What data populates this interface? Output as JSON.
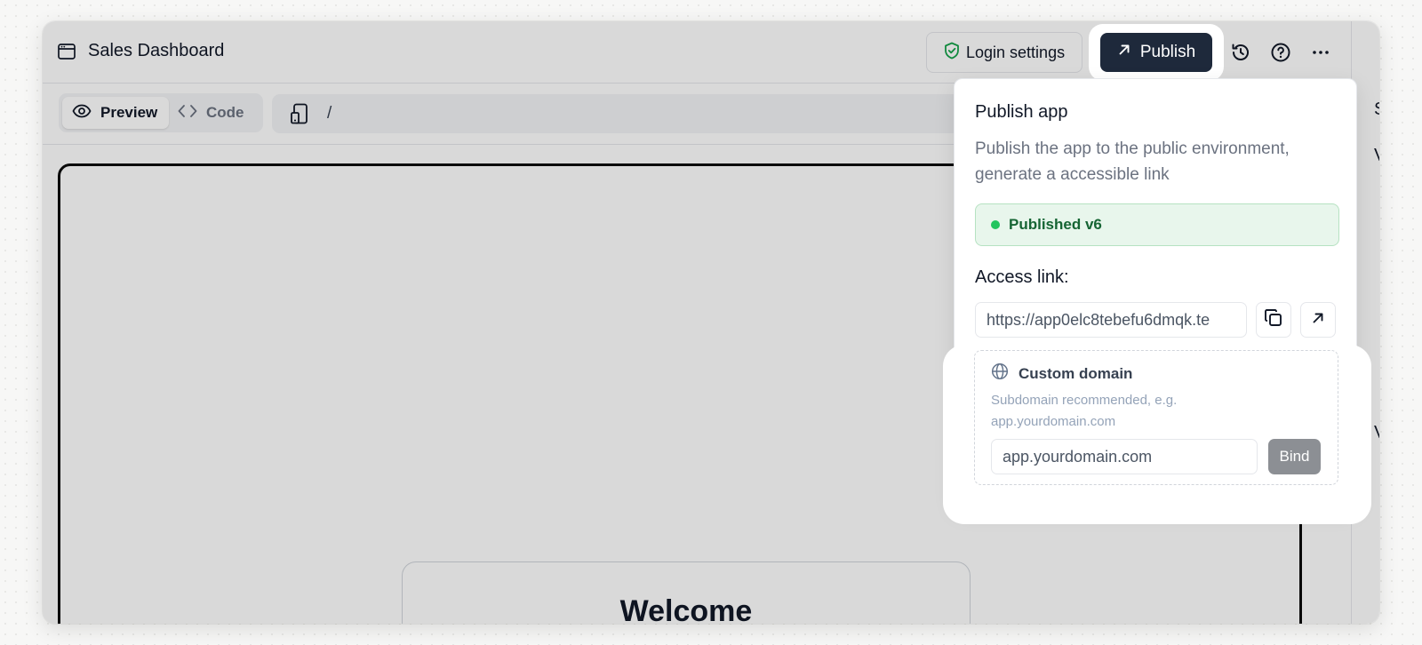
{
  "app": {
    "title": "Sales Dashboard"
  },
  "header": {
    "login_settings_label": "Login settings",
    "publish_label": "Publish"
  },
  "toolbar": {
    "preview_label": "Preview",
    "code_label": "Code",
    "route": "/"
  },
  "canvas": {
    "welcome_title": "Welcome"
  },
  "publish_popover": {
    "title": "Publish app",
    "description": "Publish the app to the public environment, generate a accessible link",
    "status": "Published v6",
    "access_label": "Access link:",
    "access_url": "https://app0elc8tebefu6dmqk.te",
    "custom_domain": {
      "title": "Custom domain",
      "hint": "Subdomain recommended, e.g. app.yourdomain.com",
      "placeholder": "app.yourdomain.com",
      "bind_label": "Bind"
    }
  },
  "colors": {
    "primary_button": "#1e293b",
    "success_text": "#166534",
    "success_bg": "#e8f6ec",
    "success_dot": "#22c55e",
    "shield_icon": "#16a34a",
    "bind_disabled": "#8c8f94"
  },
  "icons": [
    "window-icon",
    "shield-check-icon",
    "arrow-up-right-icon",
    "history-icon",
    "help-icon",
    "more-icon",
    "eye-icon",
    "code-icon",
    "device-icon",
    "copy-icon",
    "external-link-icon",
    "globe-icon"
  ]
}
